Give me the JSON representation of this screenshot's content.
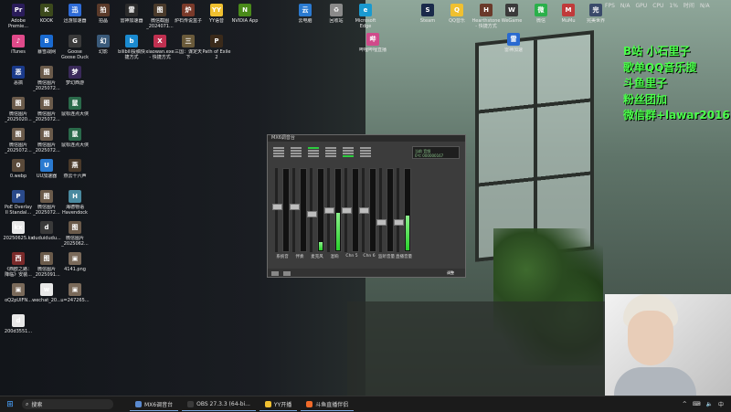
{
  "desktop_icons": [
    {
      "label": "Adobe\nPremie...",
      "color": "#2a1c5a",
      "glyph": "Pr"
    },
    {
      "label": "KOOK",
      "color": "#3c4a1c",
      "glyph": "K"
    },
    {
      "label": "迅游加速器",
      "color": "#2e6bd6",
      "glyph": "迅"
    },
    {
      "label": "拍晶",
      "color": "#5a3a2a",
      "glyph": "拍"
    },
    {
      "label": "雷神加速器",
      "color": "#2b2b2b",
      "glyph": "雷"
    },
    {
      "label": "微信截图\n_2024071...",
      "color": "#4a3a2a",
      "glyph": "图"
    },
    {
      "label": "炉石传说盒子",
      "color": "#7a3a2a",
      "glyph": "炉"
    },
    {
      "label": "YY语音",
      "color": "#f0c030",
      "glyph": "YY"
    },
    {
      "label": "NVIDIA App",
      "color": "#4a8a1a",
      "glyph": "N"
    },
    {
      "label": "iTunes",
      "color": "#e04a8a",
      "glyph": "♪"
    },
    {
      "label": "暴雪战网",
      "color": "#1a6ad0",
      "glyph": "B"
    },
    {
      "label": "Goose\nGoose Duck",
      "color": "#3a3a3a",
      "glyph": "G"
    },
    {
      "label": "幻影",
      "color": "#3a5a7a",
      "glyph": "幻"
    },
    {
      "label": "bilibili投稿快\n捷方式",
      "color": "#1a8ad0",
      "glyph": "b"
    },
    {
      "label": "xiaowan.exe\n- 快捷方式",
      "color": "#c03050",
      "glyph": "X"
    },
    {
      "label": "三国：谋定天\n下",
      "color": "#6a5a3a",
      "glyph": "三"
    },
    {
      "label": "Path of Exile\n2",
      "color": "#3a2a1a",
      "glyph": "P"
    },
    {
      "label": "恶搞",
      "color": "#1a3a8a",
      "glyph": "恶"
    },
    {
      "label": "微信图片\n_2025072...",
      "color": "#6a5a4a",
      "glyph": "图"
    },
    {
      "label": "梦幻西游",
      "color": "#3a2a5a",
      "glyph": "梦"
    },
    {
      "label": "微信图片\n_2025020...",
      "color": "#6a5a4a",
      "glyph": "图"
    },
    {
      "label": "微信图片\n_2025072...",
      "color": "#6a5a4a",
      "glyph": "图"
    },
    {
      "label": "鼠标连点大侠",
      "color": "#2a6a4a",
      "glyph": "鼠"
    },
    {
      "label": "微信图片\n_2025072...",
      "color": "#6a5a4a",
      "glyph": "图"
    },
    {
      "label": "微信图片\n_2025072...",
      "color": "#6a5a4a",
      "glyph": "图"
    },
    {
      "label": "鼠标连点大侠",
      "color": "#2a6a4a",
      "glyph": "鼠"
    },
    {
      "label": "0.webp",
      "color": "#5a4a3a",
      "glyph": "0"
    },
    {
      "label": "UU加速器",
      "color": "#2a7ad0",
      "glyph": "U"
    },
    {
      "label": "燕云十六声",
      "color": "#4a3a2a",
      "glyph": "燕"
    },
    {
      "label": "PoE Overlay\nII Standal...",
      "color": "#2a4a8a",
      "glyph": "P"
    },
    {
      "label": "微信图片\n_2025072...",
      "color": "#6a5a4a",
      "glyph": "图"
    },
    {
      "label": "海德物语\nHavendock",
      "color": "#4a8aa0",
      "glyph": "H"
    },
    {
      "label": "20250625.kx",
      "color": "#e8e8e8",
      "glyph": "kx"
    },
    {
      "label": "duduidudu...",
      "color": "#3a3a3a",
      "glyph": "d"
    },
    {
      "label": "微信图片\n_2025062...",
      "color": "#6a5a4a",
      "glyph": "图"
    },
    {
      "label": "《西欧之路：\n降临》安装...",
      "color": "#7a2a2a",
      "glyph": "西"
    },
    {
      "label": "微信图片\n_2025091...",
      "color": "#6a5a4a",
      "glyph": "图"
    },
    {
      "label": "4141.png",
      "color": "#7a6a5a",
      "glyph": "▣"
    },
    {
      "label": "oQ2pUIFN...",
      "color": "#7a6a5a",
      "glyph": "▣"
    },
    {
      "label": "wechat_20...",
      "color": "#e8e8e8",
      "glyph": "w"
    },
    {
      "label": "u=247265...",
      "color": "#7a6a5a",
      "glyph": "▣"
    },
    {
      "label": "200d3551...",
      "color": "#e8e8e8",
      "glyph": "d"
    }
  ],
  "desktop_icons_top": [
    {
      "label": "云电脑",
      "color": "#2a7ad0",
      "glyph": "云"
    },
    {
      "label": "回收站",
      "color": "#8a8a8a",
      "glyph": "♻"
    },
    {
      "label": "Microsoft\nEdge",
      "color": "#1a9ad0",
      "glyph": "e"
    },
    {
      "label": "哔哩哔哩直播",
      "color": "#d04a8a",
      "glyph": "哔"
    },
    {
      "label": "Steam",
      "color": "#1a2a4a",
      "glyph": "S"
    },
    {
      "label": "QQ音乐",
      "color": "#f0c030",
      "glyph": "Q"
    },
    {
      "label": "Hearthstone\n- 快捷方式",
      "color": "#6a3a2a",
      "glyph": "H"
    },
    {
      "label": "WeGame",
      "color": "#3a3a3a",
      "glyph": "W"
    },
    {
      "label": "微信",
      "color": "#2ab04a",
      "glyph": "微"
    },
    {
      "label": "MuMu",
      "color": "#c03a3a",
      "glyph": "M"
    },
    {
      "label": "完美世界",
      "color": "#3a4a6a",
      "glyph": "完"
    },
    {
      "label": "雷神加速",
      "color": "#2a6ad0",
      "glyph": "雷"
    }
  ],
  "mixer": {
    "title": "MX6调音台",
    "display_line1": "当前 音频",
    "display_line2": "0℃  000000167",
    "channels": [
      {
        "label": "系统音",
        "fader": 0.55,
        "meter": 0.0
      },
      {
        "label": "伴奏",
        "fader": 0.55,
        "meter": 0.0
      },
      {
        "label": "麦克风",
        "fader": 0.45,
        "meter": 0.1
      },
      {
        "label": "混响",
        "fader": 0.5,
        "meter": 0.45
      },
      {
        "label": "Chn 5",
        "fader": 0.5,
        "meter": 0.0
      },
      {
        "label": "Chn 6",
        "fader": 0.5,
        "meter": 0.0
      },
      {
        "label": "监听音量",
        "fader": 0.35,
        "meter": 0.0
      },
      {
        "label": "直播音量",
        "fader": 0.35,
        "meter": 0.42
      }
    ],
    "head_buttons": [
      "美",
      "响",
      "话",
      "静"
    ],
    "footer_label": "调整"
  },
  "overlay": {
    "line1": "B站 小石里子",
    "line2": "歌单QQ音乐搜",
    "line3": "斗鱼里子",
    "line4": "粉丝团加",
    "line5": "微信群+lawar2016"
  },
  "topbar": {
    "fps": "FPS",
    "na1": "N/A",
    "gpu": "GPU",
    "cpu": "CPU",
    "cpu_pct": "1%",
    "time_label": "时间",
    "na2": "N/A"
  },
  "taskbar": {
    "search_label": "搜索",
    "apps": [
      {
        "label": "MX6调音台",
        "color": "#5a8ad0"
      },
      {
        "label": "OBS 27.3.3 (64-bi...",
        "color": "#3a3a3a"
      },
      {
        "label": "YY开播",
        "color": "#f0c030"
      },
      {
        "label": "斗鱼直播伴侣",
        "color": "#f06a2a"
      }
    ],
    "tray": [
      "^",
      "⌨",
      "🔈",
      "中"
    ]
  },
  "colors": {
    "overlay_text": "#4bff4b",
    "meter_green": "#29d12b",
    "accent": "#4aa3ff"
  }
}
